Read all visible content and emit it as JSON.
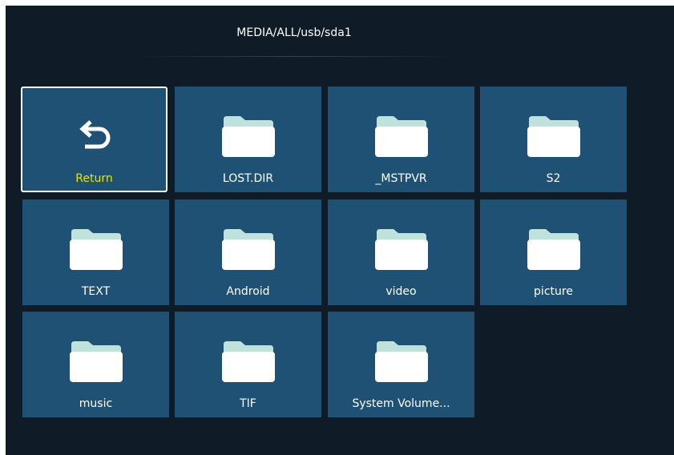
{
  "header": {
    "path": "MEDIA/ALL/usb/sda1"
  },
  "grid": {
    "items": [
      {
        "label": "Return",
        "icon": "return-arrow-icon",
        "focused": true
      },
      {
        "label": "LOST.DIR",
        "icon": "folder-icon"
      },
      {
        "label": "_MSTPVR",
        "icon": "folder-icon"
      },
      {
        "label": "S2",
        "icon": "folder-icon"
      },
      {
        "label": "TEXT",
        "icon": "folder-icon"
      },
      {
        "label": "Android",
        "icon": "folder-icon"
      },
      {
        "label": "video",
        "icon": "folder-icon"
      },
      {
        "label": "picture",
        "icon": "folder-icon"
      },
      {
        "label": "music",
        "icon": "folder-icon"
      },
      {
        "label": "TIF",
        "icon": "folder-icon"
      },
      {
        "label": "System Volume...",
        "icon": "folder-icon"
      }
    ]
  },
  "colors": {
    "background": "#0f1b26",
    "tile": "#1e5173",
    "focus_label": "#e6e600",
    "folder_tab": "#bfe3dc",
    "folder_body": "#ffffff"
  }
}
